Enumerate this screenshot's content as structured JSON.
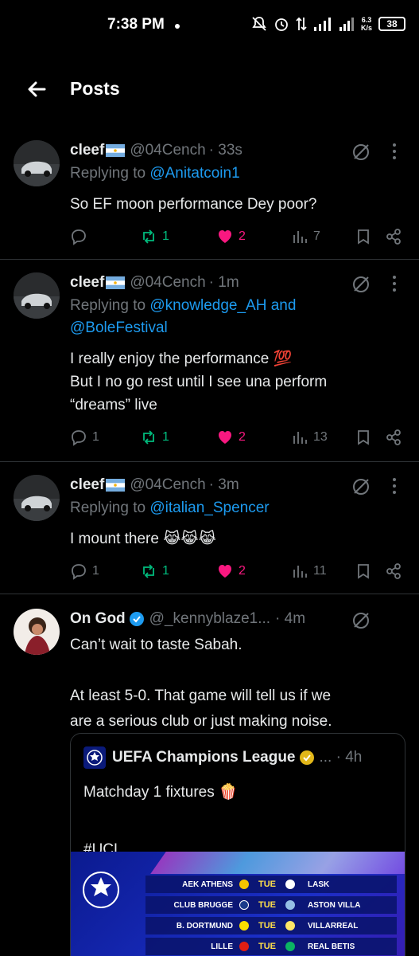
{
  "status_bar": {
    "time": "7:38 PM",
    "net_speed": "6.3\nK/s",
    "battery": "38",
    "network": "4G"
  },
  "header": {
    "title": "Posts",
    "back_icon": "arrow-left-icon"
  },
  "tweets": [
    {
      "name": "cleef",
      "handle": "@04Cench",
      "time": "· 33s",
      "reply_prefix": "Replying to ",
      "reply_to": "@Anitatcoin1",
      "reply_to_2": "",
      "text": "So EF moon performance Dey poor?",
      "replies": "",
      "reposts": "1",
      "likes": "2",
      "views": "7"
    },
    {
      "name": "cleef",
      "handle": "@04Cench",
      "time": "· 1m",
      "reply_prefix": "Replying to ",
      "reply_to": "@knowledge_AH and",
      "reply_to_2": "@BoleFestival",
      "text": "I really enjoy the performance 💯\nBut I no go rest until I see una perform\n“dreams” live",
      "replies": "1",
      "reposts": "1",
      "likes": "2",
      "views": "13"
    },
    {
      "name": "cleef",
      "handle": "@04Cench",
      "time": "· 3m",
      "reply_prefix": "Replying to ",
      "reply_to": "@italian_Spencer",
      "reply_to_2": "",
      "text": "I mount there 😹😹😹",
      "replies": "1",
      "reposts": "1",
      "likes": "2",
      "views": "11"
    },
    {
      "name": "On God",
      "handle": "@_kennyblaze1...",
      "time": "· 4m",
      "text": "Can’t wait to taste Sabah.\n\nAt least 5-0. That game will tell us if we\nare a serious club or just making noise.",
      "quote": {
        "name": "UEFA Champions League",
        "time": "... · 4h",
        "text": "Matchday 1 fixtures 🍿\n\n#UCL",
        "fixtures": [
          {
            "home": "AEK ATHENS",
            "day": "TUE",
            "away": "LASK",
            "home_color": "#f5c400",
            "away_color": "#ffffff"
          },
          {
            "home": "CLUB BRUGGE",
            "day": "TUE",
            "away": "ASTON VILLA",
            "home_color": "#1a3a8a",
            "away_color": "#95bfe5"
          },
          {
            "home": "B. DORTMUND",
            "day": "TUE",
            "away": "VILLARREAL",
            "home_color": "#fde100",
            "away_color": "#ffe667"
          },
          {
            "home": "LILLE",
            "day": "TUE",
            "away": "REAL BETIS",
            "home_color": "#e01e13",
            "away_color": "#0bb363"
          }
        ]
      }
    }
  ],
  "colors": {
    "accent": "#1d9bf0",
    "repost": "#00ba7c",
    "like": "#f91880",
    "muted": "#71767b"
  }
}
